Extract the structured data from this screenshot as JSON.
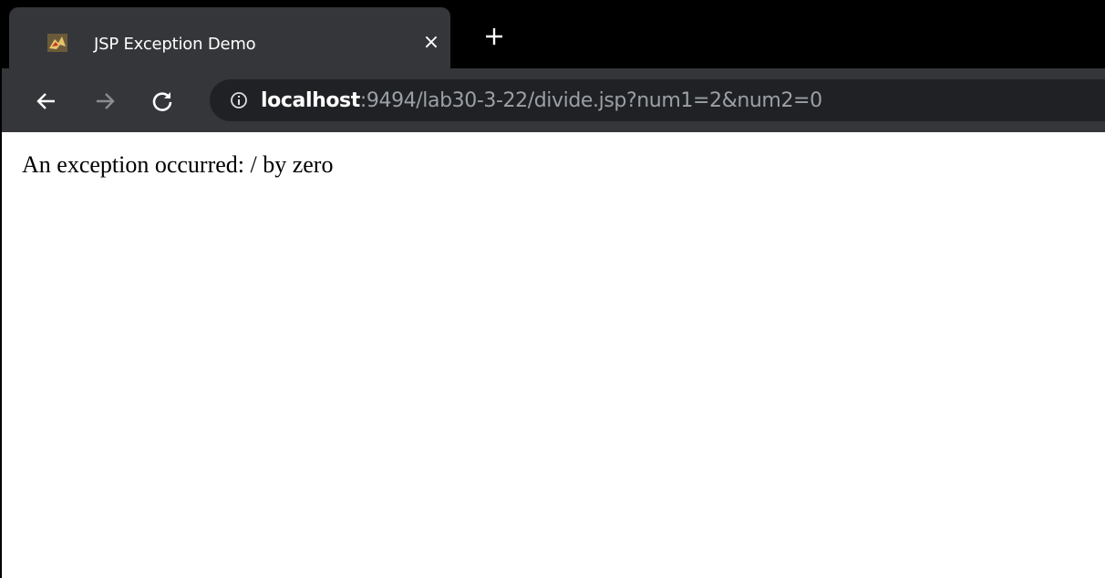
{
  "tab": {
    "title": "JSP Exception Demo",
    "close_label": "×",
    "favicon": "tomcat-icon"
  },
  "toolbar": {
    "back_icon": "back-arrow-icon",
    "forward_icon": "forward-arrow-icon",
    "reload_icon": "reload-icon",
    "new_tab_icon": "plus-icon"
  },
  "omnibox": {
    "info_icon": "info-icon",
    "url_host": "localhost",
    "url_rest": ":9494/lab30-3-22/divide.jsp?num1=2&num2=0"
  },
  "page": {
    "message": "An exception occurred: / by zero"
  },
  "colors": {
    "tabstrip": "#000000",
    "toolbar": "#35363a",
    "omnibox": "#202124",
    "url_dim": "#9aa0a6"
  }
}
